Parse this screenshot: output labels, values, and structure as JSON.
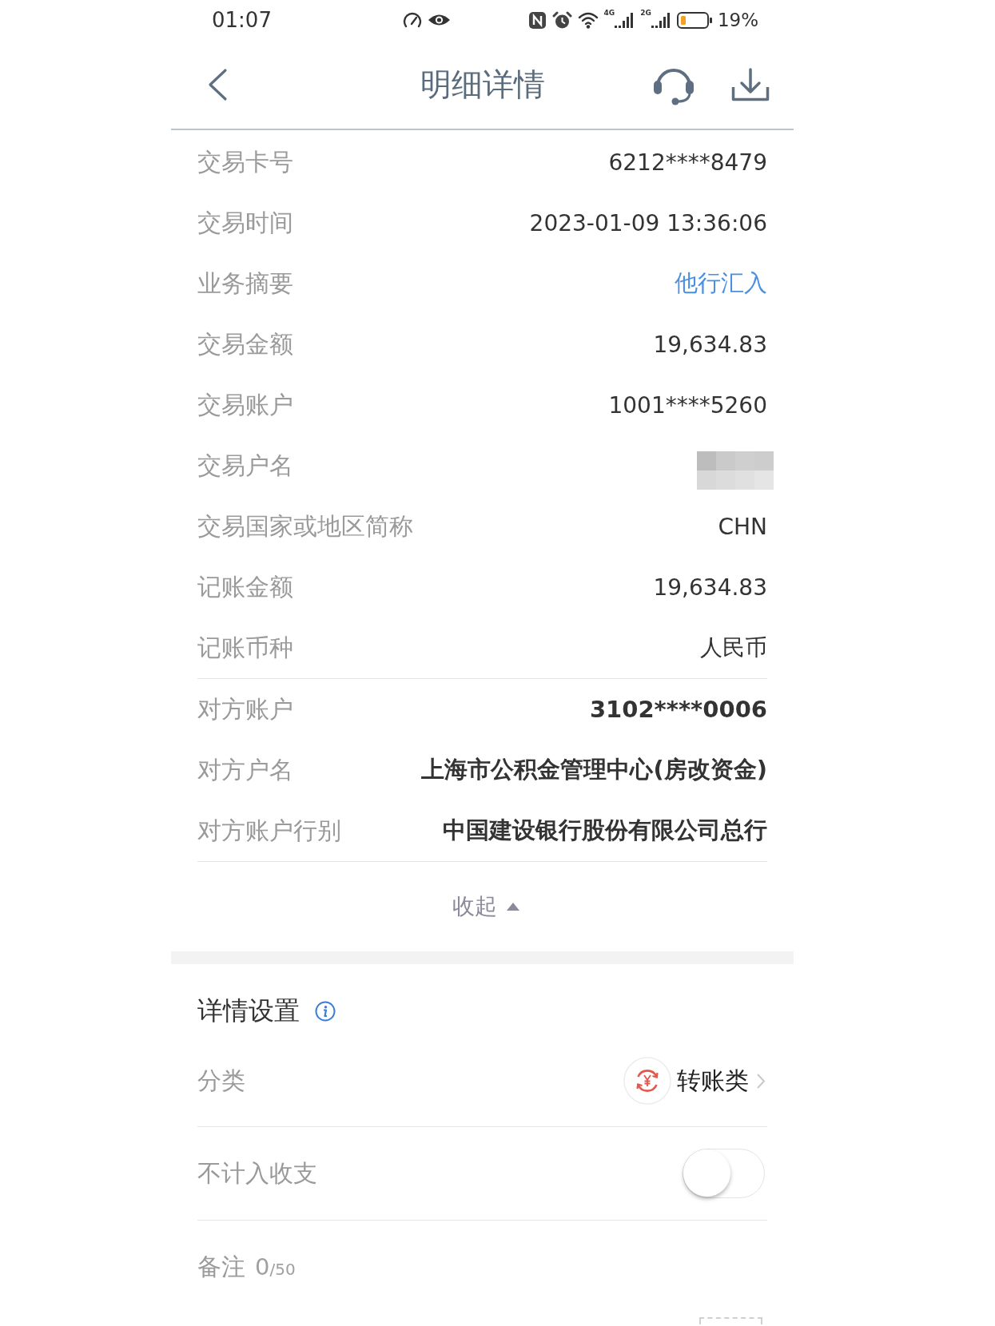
{
  "status_bar": {
    "time": "01:07",
    "network": [
      {
        "label": "4G"
      },
      {
        "label": "2G"
      }
    ],
    "battery": "19%"
  },
  "header": {
    "title": "明细详情"
  },
  "details": [
    {
      "label": "交易卡号",
      "value": "6212****8479",
      "kind": "plain"
    },
    {
      "label": "交易时间",
      "value": "2023-01-09 13:36:06",
      "kind": "plain"
    },
    {
      "label": "业务摘要",
      "value": "他行汇入",
      "kind": "link"
    },
    {
      "label": "交易金额",
      "value": "19,634.83",
      "kind": "plain"
    },
    {
      "label": "交易账户",
      "value": "1001****5260",
      "kind": "plain"
    },
    {
      "label": "交易户名",
      "kind": "redacted"
    },
    {
      "label": "交易国家或地区简称",
      "value": "CHN",
      "kind": "plain"
    },
    {
      "label": "记账金额",
      "value": "19,634.83",
      "kind": "plain"
    },
    {
      "label": "记账币种",
      "value": "人民币",
      "kind": "plain"
    }
  ],
  "counterparty": [
    {
      "label": "对方账户",
      "value": "3102****0006",
      "kind": "bold"
    },
    {
      "label": "对方户名",
      "value": "上海市公积金管理中心(房改资金)",
      "kind": "bold"
    },
    {
      "label": "对方账户行别",
      "value": "中国建设银行股份有限公司总行",
      "kind": "bold"
    }
  ],
  "collapse": {
    "label": "收起",
    "expanded": true
  },
  "settings": {
    "title": "详情设置",
    "category": {
      "label": "分类",
      "value": "转账类"
    },
    "exclude": {
      "label": "不计入收支",
      "on": false
    },
    "remark": {
      "label": "备注",
      "count": "0",
      "limit": "/50"
    }
  }
}
